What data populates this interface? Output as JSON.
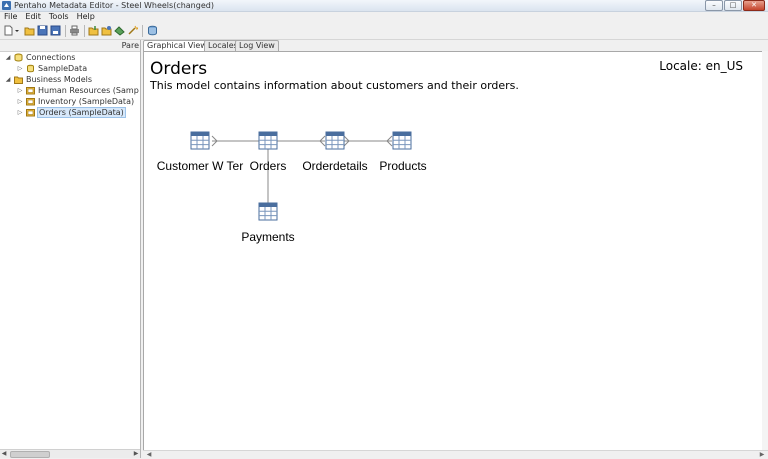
{
  "window": {
    "title": "Pentaho Metadata Editor - Steel Wheels(changed)"
  },
  "menu": [
    "File",
    "Edit",
    "Tools",
    "Help"
  ],
  "left_pane": {
    "header_label": "Pare",
    "tree": [
      {
        "label": "Connections",
        "icon": "database-icon",
        "expanded": true
      },
      {
        "label": "SampleData",
        "icon": "connection-icon"
      },
      {
        "label": "Business Models",
        "icon": "folder-icon",
        "expanded": true
      },
      {
        "label": "Human Resources (Samp",
        "icon": "model-icon"
      },
      {
        "label": "Inventory (SampleData)",
        "icon": "model-icon"
      },
      {
        "label": "Orders (SampleData)",
        "icon": "model-icon",
        "selected": true
      }
    ]
  },
  "tabs": [
    "Graphical View",
    "Locales",
    "Log View"
  ],
  "view": {
    "title": "Orders",
    "description": "This model contains information about customers and their orders.",
    "locale": "Locale: en_US"
  },
  "diagram": {
    "tables": [
      {
        "label": "Customer W Ter"
      },
      {
        "label": "Orders"
      },
      {
        "label": "Orderdetails"
      },
      {
        "label": "Products"
      },
      {
        "label": "Payments"
      }
    ]
  }
}
